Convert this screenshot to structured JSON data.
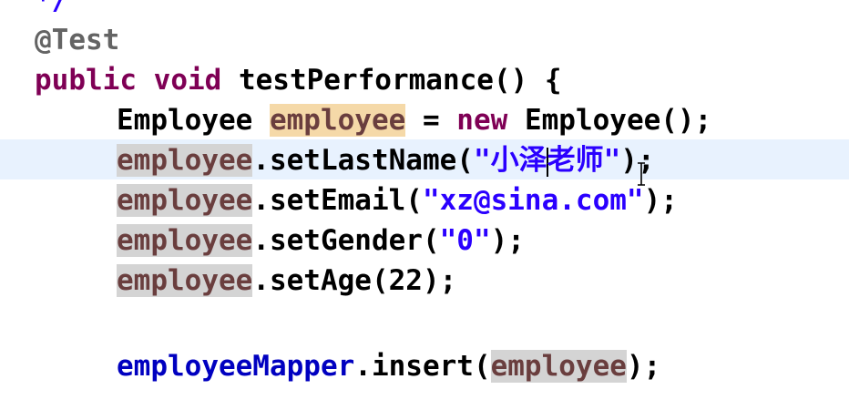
{
  "editor": {
    "partial_top": "*/",
    "lines": {
      "annotation": "@Test",
      "method_sig": {
        "kw_public": "public",
        "kw_void": "void",
        "rest": " testPerformance() {"
      },
      "decl": {
        "type": "Employee",
        "var": "employee",
        "eq": " = ",
        "kw_new": "new",
        "ctor": " Employee();"
      },
      "set_last_name": {
        "var": "employee",
        "call": ".setLastName(",
        "str_a": "\"小泽",
        "str_b": "老师\"",
        "end": ");"
      },
      "set_email": {
        "var": "employee",
        "call": ".setEmail(",
        "str": "\"xz@sina.com\"",
        "end": ");"
      },
      "set_gender": {
        "var": "employee",
        "call": ".setGender(",
        "str": "\"0\"",
        "end": ");"
      },
      "set_age": {
        "var": "employee",
        "call": ".setAge(22);"
      },
      "insert": {
        "field": "employeeMapper",
        "call": ".insert(",
        "var": "employee",
        "end": ");"
      }
    },
    "cursor_icon": "ibeam-cursor-icon"
  }
}
